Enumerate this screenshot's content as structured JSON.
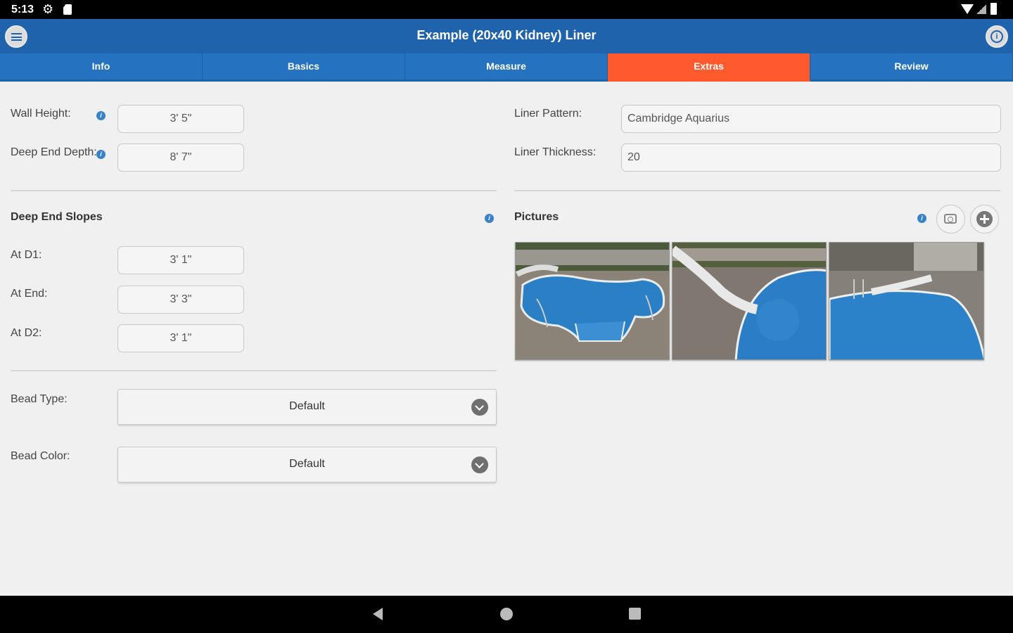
{
  "status_bar": {
    "time": "5:13"
  },
  "app_bar": {
    "title": "Example (20x40 Kidney) Liner"
  },
  "tabs": [
    {
      "label": "Info",
      "active": false
    },
    {
      "label": "Basics",
      "active": false
    },
    {
      "label": "Measure",
      "active": false
    },
    {
      "label": "Extras",
      "active": true
    },
    {
      "label": "Review",
      "active": false
    }
  ],
  "left": {
    "wall_height": {
      "label": "Wall Height:",
      "value": "3' 5\""
    },
    "deep_end_depth": {
      "label": "Deep End Depth:",
      "value": "8' 7\""
    },
    "slopes": {
      "heading": "Deep End Slopes",
      "at_d1": {
        "label": "At D1:",
        "value": "3' 1\""
      },
      "at_end": {
        "label": "At End:",
        "value": "3' 3\""
      },
      "at_d2": {
        "label": "At D2:",
        "value": "3' 1\""
      }
    },
    "bead_type": {
      "label": "Bead Type:",
      "value": "Default"
    },
    "bead_color": {
      "label": "Bead Color:",
      "value": "Default"
    }
  },
  "right": {
    "liner_pattern": {
      "label": "Liner Pattern:",
      "value": "Cambridge Aquarius"
    },
    "liner_thickness": {
      "label": "Liner Thickness:",
      "value": "20"
    },
    "pictures": {
      "heading": "Pictures",
      "count": 3
    }
  },
  "colors": {
    "app_bar": "#1f63ad",
    "tab_bar": "#2472c0",
    "active_tab": "#ff5a2e",
    "info_icon": "#3a82c8",
    "background": "#f0f0f0"
  },
  "icons": {
    "menu": "menu-icon",
    "info": "info-icon",
    "camera": "camera-icon",
    "add": "add-icon",
    "chevron": "chevron-down-icon"
  }
}
